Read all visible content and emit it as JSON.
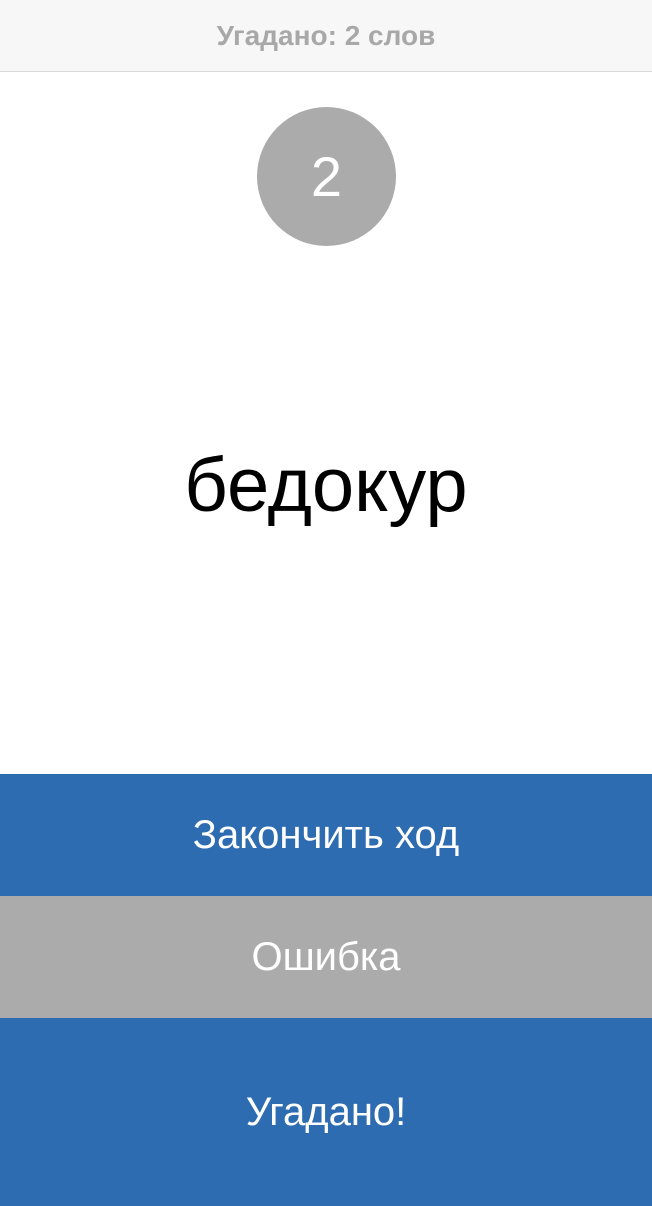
{
  "header": {
    "guessed_label": "Угадано: 2 слов"
  },
  "timer": {
    "value": "2"
  },
  "card": {
    "word": "бедокур"
  },
  "buttons": {
    "end_turn": "Закончить ход",
    "mistake": "Ошибка",
    "guessed": "Угадано!"
  },
  "colors": {
    "primary_blue": "#2e6cb1",
    "neutral_gray": "#ababab",
    "header_bg": "#f7f7f7",
    "header_text": "#a8a8a8"
  }
}
